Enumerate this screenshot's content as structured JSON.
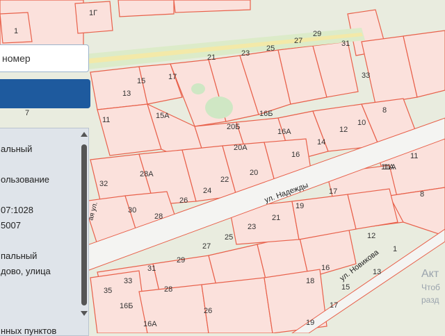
{
  "search": {
    "placeholder_text": "номер"
  },
  "panel": {
    "lines": [
      "альный",
      "ользование",
      "07:1028",
      "5007",
      "пальный",
      "дово, улица",
      "нных пунктов"
    ]
  },
  "streets": {
    "nadezhdy": "ул. Надежды",
    "novikova": "ул. Новикова",
    "side": "ая ул."
  },
  "plots": [
    "1Г",
    "1",
    "21",
    "23",
    "25",
    "27",
    "29",
    "31",
    "33",
    "8",
    "17",
    "15",
    "13",
    "7",
    "11",
    "15А",
    "16Б",
    "20Б",
    "16А",
    "12",
    "10",
    "14",
    "20А",
    "16",
    "11А",
    "28А",
    "22",
    "20",
    "32",
    "24",
    "26",
    "30",
    "28",
    "17",
    "19",
    "21",
    "23",
    "25",
    "27",
    "29",
    "31",
    "33",
    "28",
    "35",
    "16Б",
    "26",
    "16А",
    "18",
    "16",
    "15",
    "13",
    "17",
    "19",
    "11",
    "11А",
    "8",
    "12",
    "1"
  ],
  "watermark": {
    "line1": "Акт",
    "line2": "Чтоб",
    "line3": "разд"
  },
  "colors": {
    "parcel_fill": "#fbe1dc",
    "parcel_stroke": "#e8604a",
    "road": "#f6f6f4",
    "green": "#cfe7c4",
    "search_button": "#1e5a9e"
  }
}
